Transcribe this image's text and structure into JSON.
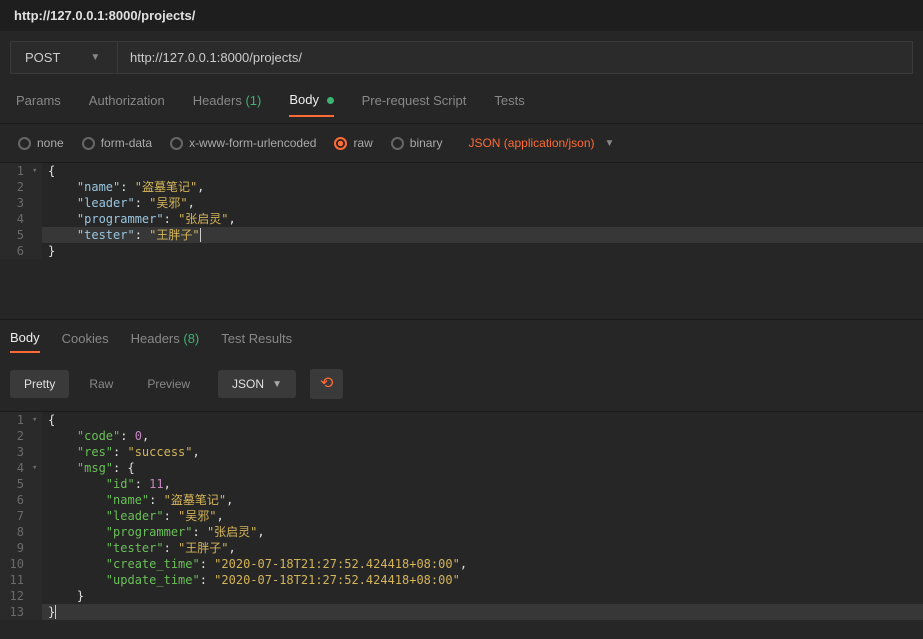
{
  "title": "http://127.0.0.1:8000/projects/",
  "method": "POST",
  "url": "http://127.0.0.1:8000/projects/",
  "request_tabs": {
    "params": "Params",
    "auth": "Authorization",
    "headers_label": "Headers",
    "headers_count": "(1)",
    "body": "Body",
    "prescript": "Pre-request Script",
    "tests": "Tests"
  },
  "body_types": {
    "none": "none",
    "formdata": "form-data",
    "xwww": "x-www-form-urlencoded",
    "raw": "raw",
    "binary": "binary"
  },
  "content_type": "JSON (application/json)",
  "request_body": [
    {
      "n": "1",
      "fold": "▾",
      "t": [
        [
          "p",
          "{"
        ]
      ]
    },
    {
      "n": "2",
      "t": [
        [
          "p",
          "    "
        ],
        [
          "k",
          "\"name\""
        ],
        [
          "p",
          ": "
        ],
        [
          "s",
          "\"盗墓笔记\""
        ],
        [
          "p",
          ","
        ]
      ]
    },
    {
      "n": "3",
      "t": [
        [
          "p",
          "    "
        ],
        [
          "k",
          "\"leader\""
        ],
        [
          "p",
          ": "
        ],
        [
          "s",
          "\"吴邪\""
        ],
        [
          "p",
          ","
        ]
      ]
    },
    {
      "n": "4",
      "t": [
        [
          "p",
          "    "
        ],
        [
          "k",
          "\"programmer\""
        ],
        [
          "p",
          ": "
        ],
        [
          "s",
          "\"张启灵\""
        ],
        [
          "p",
          ","
        ]
      ]
    },
    {
      "n": "5",
      "hi": true,
      "t": [
        [
          "p",
          "    "
        ],
        [
          "k",
          "\"tester\""
        ],
        [
          "p",
          ": "
        ],
        [
          "s",
          "\"王胖子\""
        ]
      ],
      "cursor": true
    },
    {
      "n": "6",
      "t": [
        [
          "p",
          "}"
        ]
      ]
    }
  ],
  "response_tabs": {
    "body": "Body",
    "cookies": "Cookies",
    "headers_label": "Headers",
    "headers_count": "(8)",
    "tests": "Test Results"
  },
  "toolbar": {
    "pretty": "Pretty",
    "raw": "Raw",
    "preview": "Preview",
    "json": "JSON"
  },
  "response_body": [
    {
      "n": "1",
      "fold": "▾",
      "t": [
        [
          "p",
          "{"
        ]
      ]
    },
    {
      "n": "2",
      "t": [
        [
          "p",
          "    "
        ],
        [
          "kg",
          "\"code\""
        ],
        [
          "p",
          ": "
        ],
        [
          "n",
          "0"
        ],
        [
          "p",
          ","
        ]
      ]
    },
    {
      "n": "3",
      "t": [
        [
          "p",
          "    "
        ],
        [
          "kg",
          "\"res\""
        ],
        [
          "p",
          ": "
        ],
        [
          "s",
          "\"success\""
        ],
        [
          "p",
          ","
        ]
      ]
    },
    {
      "n": "4",
      "fold": "▾",
      "t": [
        [
          "p",
          "    "
        ],
        [
          "kg",
          "\"msg\""
        ],
        [
          "p",
          ": {"
        ]
      ]
    },
    {
      "n": "5",
      "t": [
        [
          "p",
          "        "
        ],
        [
          "kg",
          "\"id\""
        ],
        [
          "p",
          ": "
        ],
        [
          "n",
          "11"
        ],
        [
          "p",
          ","
        ]
      ]
    },
    {
      "n": "6",
      "t": [
        [
          "p",
          "        "
        ],
        [
          "kg",
          "\"name\""
        ],
        [
          "p",
          ": "
        ],
        [
          "s",
          "\"盗墓笔记\""
        ],
        [
          "p",
          ","
        ]
      ]
    },
    {
      "n": "7",
      "t": [
        [
          "p",
          "        "
        ],
        [
          "kg",
          "\"leader\""
        ],
        [
          "p",
          ": "
        ],
        [
          "s",
          "\"吴邪\""
        ],
        [
          "p",
          ","
        ]
      ]
    },
    {
      "n": "8",
      "t": [
        [
          "p",
          "        "
        ],
        [
          "kg",
          "\"programmer\""
        ],
        [
          "p",
          ": "
        ],
        [
          "s",
          "\"张启灵\""
        ],
        [
          "p",
          ","
        ]
      ]
    },
    {
      "n": "9",
      "t": [
        [
          "p",
          "        "
        ],
        [
          "kg",
          "\"tester\""
        ],
        [
          "p",
          ": "
        ],
        [
          "s",
          "\"王胖子\""
        ],
        [
          "p",
          ","
        ]
      ]
    },
    {
      "n": "10",
      "t": [
        [
          "p",
          "        "
        ],
        [
          "kg",
          "\"create_time\""
        ],
        [
          "p",
          ": "
        ],
        [
          "s",
          "\"2020-07-18T21:27:52.424418+08:00\""
        ],
        [
          "p",
          ","
        ]
      ]
    },
    {
      "n": "11",
      "t": [
        [
          "p",
          "        "
        ],
        [
          "kg",
          "\"update_time\""
        ],
        [
          "p",
          ": "
        ],
        [
          "s",
          "\"2020-07-18T21:27:52.424418+08:00\""
        ]
      ]
    },
    {
      "n": "12",
      "t": [
        [
          "p",
          "    }"
        ]
      ]
    },
    {
      "n": "13",
      "hi": true,
      "t": [
        [
          "p",
          "}"
        ]
      ],
      "cursor": true
    }
  ]
}
